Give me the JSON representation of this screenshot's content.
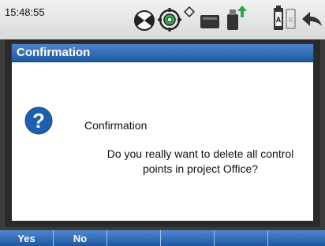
{
  "status_bar": {
    "time": "15:48:55",
    "icons": [
      "satellite-status-icon",
      "target-prism-icon",
      "radio-signal-icon",
      "memory-card-icon",
      "usb-transfer-icon",
      "battery-ab-icon",
      "back-arrow-icon"
    ]
  },
  "dialog": {
    "title": "Confirmation",
    "heading": "Confirmation",
    "message": "Do you really want to delete all control points in project Office?",
    "icon": "question-icon"
  },
  "softkeys": {
    "yes": "Yes",
    "no": "No",
    "empty": [
      "",
      "",
      "",
      ""
    ]
  },
  "colors": {
    "title_bar": "#2f6ab7",
    "softkey_bar": "#3670b8",
    "question_icon": "#1f5fb0"
  }
}
